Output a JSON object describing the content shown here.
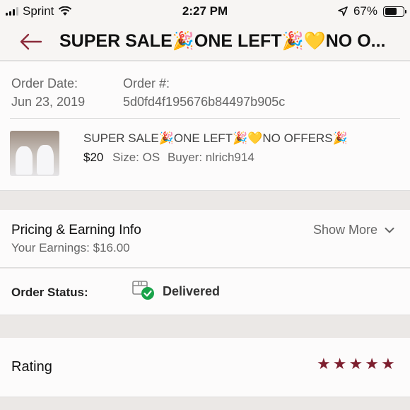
{
  "status_bar": {
    "carrier": "Sprint",
    "time": "2:27 PM",
    "battery": "67%"
  },
  "nav": {
    "title": "SUPER SALE🎉ONE LEFT🎉💛NO O..."
  },
  "order": {
    "date_label": "Order Date:",
    "date": "Jun 23, 2019",
    "number_label": "Order #:",
    "number": "5d0fd4f195676b84497b905c"
  },
  "item": {
    "title": "SUPER SALE🎉ONE LEFT🎉💛NO OFFERS🎉",
    "price": "$20",
    "size": "Size: OS",
    "buyer": "Buyer: nlrich914"
  },
  "pricing": {
    "heading": "Pricing & Earning Info",
    "earnings": "Your Earnings: $16.00",
    "show_more": "Show More"
  },
  "order_status": {
    "label": "Order Status:",
    "value": "Delivered"
  },
  "rating": {
    "label": "Rating",
    "stars": 5,
    "star_color": "#7d1f2f"
  },
  "colors": {
    "accent": "#8b2b3a",
    "success": "#1aa34a"
  }
}
